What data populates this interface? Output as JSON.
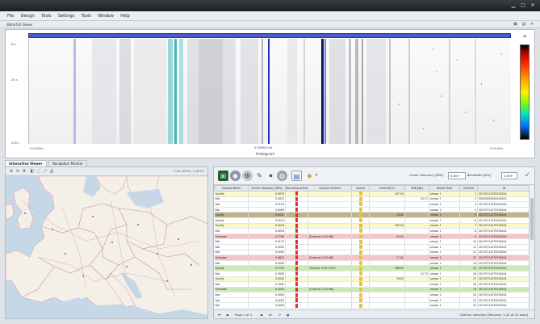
{
  "window": {
    "title": ""
  },
  "menu": [
    "File",
    "Design",
    "Tools",
    "Settings",
    "Tools",
    "Window",
    "Help"
  ],
  "spectrum": {
    "header_label": "Waterfall Viewer",
    "y_ticks": [
      "50 s",
      "-50 s",
      "-100 s"
    ],
    "x_tick_left": "0.00 MHz",
    "x_tick_right": "0.00 MHz",
    "x_axis_title": "Histogram",
    "marker_label": "0.000000 Hz",
    "colorbar_label": "dB"
  },
  "tabs": [
    "Interactive Viewer",
    "Navigation Monitor"
  ],
  "map": {
    "coord_text": "0.00, 48.00 | 1:18.00"
  },
  "grid_toolbar": {
    "center_freq_label": "Center Frequency [MHz]",
    "center_freq_value": "0.00 ▾",
    "bandwidth_label": "Bandwidth [kHz]",
    "bandwidth_value": "1.00 ▾"
  },
  "table": {
    "columns": [
      "Channel Name",
      "Center Frequency [MHz]",
      "Recording Active",
      "Channel Content",
      "Locked",
      "Level dB [1]",
      "SNR [dB]",
      "Sensor Host",
      "Channel",
      "ID"
    ],
    "rows": [
      {
        "style": "r-yellow",
        "name": "Quality",
        "freq": "0.0070",
        "content": "",
        "level": "107.00",
        "snr": "",
        "host": "sensor 1",
        "ch": "1",
        "id": "20170711075334044"
      },
      {
        "style": "r-white",
        "name": "Idle",
        "freq": "0.0051",
        "content": "",
        "level": "",
        "snr": "25.71",
        "host": "sensor 1",
        "ch": "2",
        "id": "20000000000000000"
      },
      {
        "style": "r-white",
        "name": "Idle",
        "freq": "0.0154",
        "content": "",
        "level": "",
        "snr": "",
        "host": "sensor 1",
        "ch": "3",
        "id": "20170711075334044"
      },
      {
        "style": "r-white",
        "name": "Idle",
        "freq": "0.0060",
        "content": "",
        "level": "",
        "snr": "",
        "host": "sensor 1",
        "ch": "4",
        "id": "20170711075334044"
      },
      {
        "style": "r-olive",
        "name": "Quality",
        "freq": "0.0020",
        "content": "",
        "level": "76.00",
        "snr": "",
        "host": "sensor 1",
        "ch": "5",
        "id": "20170711075334044"
      },
      {
        "style": "r-white",
        "name": "Quality",
        "freq": "0.0010",
        "content": "",
        "level": "",
        "snr": "",
        "host": "sensor 1",
        "ch": "6",
        "id": "20170711075334044"
      },
      {
        "style": "r-yellow",
        "name": "Quality",
        "freq": "0.0020",
        "content": "",
        "level": "190.00",
        "snr": "",
        "host": "sensor 1",
        "ch": "7",
        "id": "20170711075334044"
      },
      {
        "style": "r-white",
        "name": "Idle",
        "freq": "0.0054",
        "content": "",
        "level": "",
        "snr": "",
        "host": "sensor 1",
        "ch": "8",
        "id": "20170711075334044"
      },
      {
        "style": "r-red",
        "name": "Unknown",
        "freq": "0.7780",
        "content": "[Channel: 0.00 dB]",
        "level": "25.00",
        "snr": "",
        "host": "sensor 1",
        "ch": "9",
        "id": "20170711075334044"
      },
      {
        "style": "r-white",
        "name": "Idle",
        "freq": "0.0172",
        "content": "",
        "level": "",
        "snr": "",
        "host": "sensor 1",
        "ch": "10",
        "id": "20170711075334044"
      },
      {
        "style": "r-white",
        "name": "Idle",
        "freq": "0.0000",
        "content": "",
        "level": "",
        "snr": "",
        "host": "sensor 1",
        "ch": "11",
        "id": "20170711075334044"
      },
      {
        "style": "r-white",
        "name": "Idle",
        "freq": "0.0000",
        "content": "",
        "level": "",
        "snr": "",
        "host": "sensor 1",
        "ch": "12",
        "id": "20170711075334044"
      },
      {
        "style": "r-red",
        "name": "Unknown",
        "freq": "0.4832",
        "content": "[Channel: 0.00 dB]",
        "level": "17.00",
        "snr": "",
        "host": "sensor 1",
        "ch": "13",
        "id": "20170711075334044"
      },
      {
        "style": "r-white",
        "name": "Idle",
        "freq": "0.0000",
        "content": "",
        "level": "",
        "snr": "",
        "host": "sensor 1",
        "ch": "14",
        "id": "20170711075334044"
      },
      {
        "style": "r-green",
        "name": "Quality",
        "freq": "0.7750",
        "content": "Channel: 0.00 / 0.00",
        "level": "166.00",
        "snr": "",
        "host": "sensor 1",
        "ch": "15",
        "id": "20170711075334044"
      },
      {
        "style": "r-white",
        "name": "Idle",
        "freq": "0.7830",
        "content": "",
        "level": "",
        "snr": "12.73",
        "host": "sensor 1",
        "ch": "16",
        "id": "20170711075334044"
      },
      {
        "style": "r-yellow",
        "name": "Quality",
        "freq": "0.0000",
        "content": "",
        "level": "76.00",
        "snr": "",
        "host": "sensor 1",
        "ch": "17",
        "id": "20170711075334044"
      },
      {
        "style": "r-white",
        "name": "Idle",
        "freq": "0.7830",
        "content": "",
        "level": "",
        "snr": "",
        "host": "sensor 1",
        "ch": "18",
        "id": "20170711075334044"
      },
      {
        "style": "r-green",
        "name": "Unknown",
        "freq": "0.0000",
        "content": "[Channel: 0.00 dB]",
        "level": "",
        "snr": "",
        "host": "sensor 1",
        "ch": "19",
        "id": "20170711075334044"
      },
      {
        "style": "r-white",
        "name": "Idle",
        "freq": "0.2000",
        "content": "",
        "level": "",
        "snr": "",
        "host": "sensor 1",
        "ch": "20",
        "id": "20170711075334044"
      },
      {
        "style": "r-white",
        "name": "Idle",
        "freq": "0.0000",
        "content": "",
        "level": "",
        "snr": "",
        "host": "sensor 1",
        "ch": "21",
        "id": "20170711075334044"
      },
      {
        "style": "r-white",
        "name": "Idle",
        "freq": "0.0000",
        "content": "",
        "level": "",
        "snr": "",
        "host": "sensor 1",
        "ch": "22",
        "id": "20170711075334044"
      }
    ]
  },
  "footer": {
    "page_label": "Page 1 of 1",
    "status_text": "Optimal selection [Records: 1-22 of 22 total]"
  },
  "colors": {
    "marker": "#1a2fbf",
    "marker_dark": "#0d1466",
    "teal_band": "#2ab3b3",
    "colorbar_high": "#b30000"
  }
}
